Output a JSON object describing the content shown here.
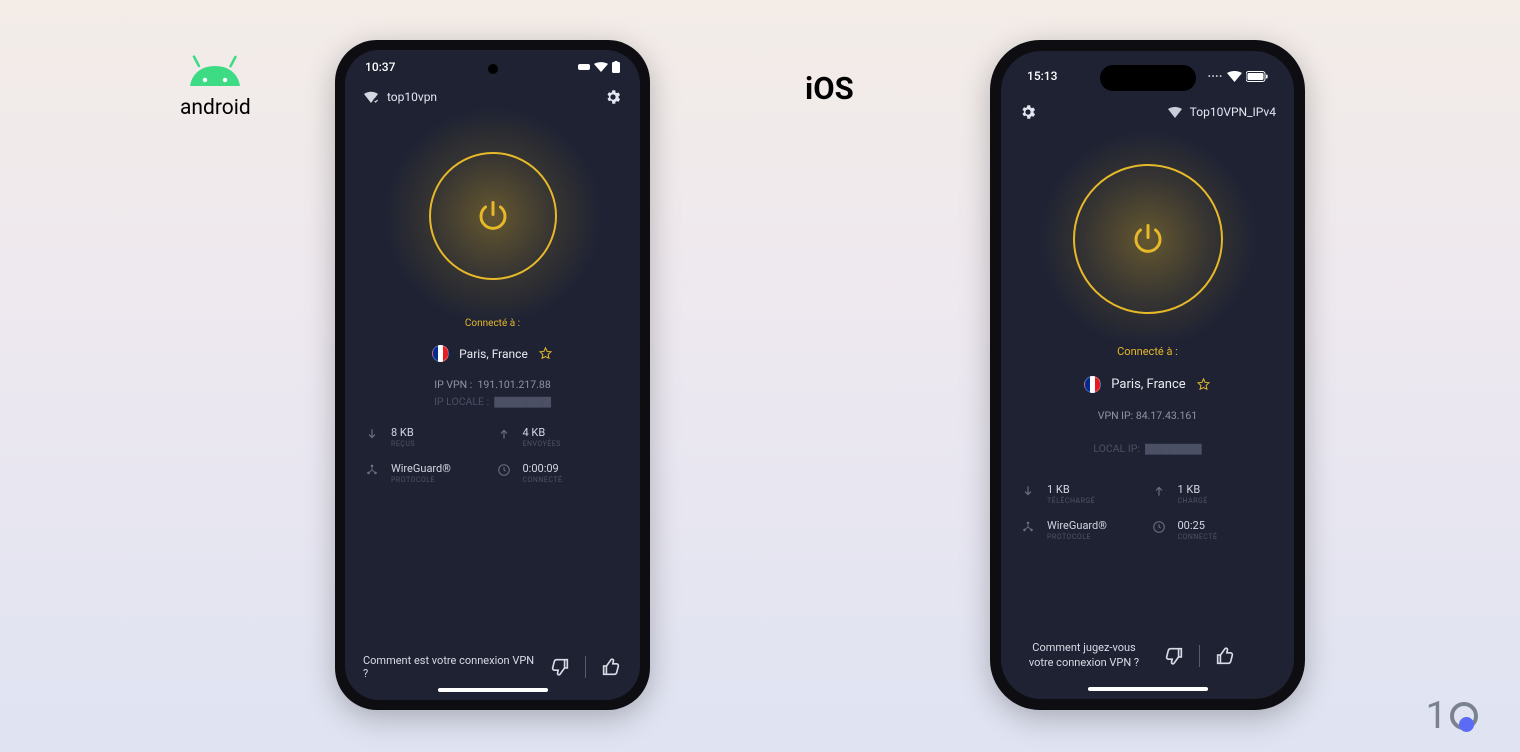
{
  "labels": {
    "android": "android",
    "ios": "iOS",
    "watermark_digit": "1"
  },
  "android": {
    "time": "10:37",
    "network_name": "top10vpn",
    "connected_label": "Connecté à :",
    "location": "Paris, France",
    "ip_vpn_label": "IP VPN :",
    "ip_vpn": "191.101.217.88",
    "ip_local_label": "IP LOCALE :",
    "stats": {
      "down_value": "8 KB",
      "down_label": "REÇUS",
      "up_value": "4 KB",
      "up_label": "ENVOYÉES",
      "proto_value": "WireGuard®",
      "proto_label": "PROTOCOLE",
      "time_value": "0:00:09",
      "time_label": "CONNECTÉ"
    },
    "feedback_q": "Comment est votre connexion VPN ?"
  },
  "ios": {
    "time": "15:13",
    "network_name": "Top10VPN_IPv4",
    "connected_label": "Connecté à :",
    "location": "Paris, France",
    "ip_vpn_label": "VPN IP:",
    "ip_vpn": "84.17.43.161",
    "ip_local_label": "LOCAL IP:",
    "stats": {
      "down_value": "1 KB",
      "down_label": "TÉLÉCHARGÉ",
      "up_value": "1 KB",
      "up_label": "CHARGÉ",
      "proto_value": "WireGuard®",
      "proto_label": "PROTOCOLE",
      "time_value": "00:25",
      "time_label": "CONNECTÉ"
    },
    "feedback_q": "Comment jugez-vous votre connexion VPN ?"
  }
}
